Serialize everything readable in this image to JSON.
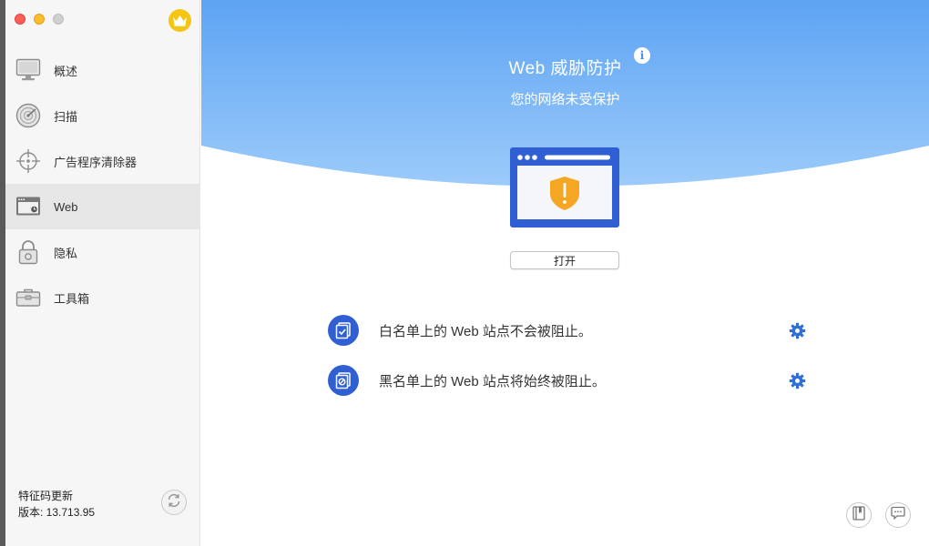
{
  "window": {
    "traffic_lights": [
      "close",
      "minimize",
      "maximize"
    ],
    "premium_icon": "crown-icon"
  },
  "sidebar": {
    "items": [
      {
        "label": "概述",
        "icon": "monitor-icon",
        "active": false
      },
      {
        "label": "扫描",
        "icon": "radar-icon",
        "active": false
      },
      {
        "label": "广告程序清除器",
        "icon": "crosshair-icon",
        "active": false
      },
      {
        "label": "Web",
        "icon": "browser-icon",
        "active": true
      },
      {
        "label": "隐私",
        "icon": "lock-icon",
        "active": false
      },
      {
        "label": "工具箱",
        "icon": "toolbox-icon",
        "active": false
      }
    ],
    "update": {
      "title": "特征码更新",
      "version": "版本: 13.713.95"
    }
  },
  "main": {
    "title": "Web 威胁防护",
    "subtitle": "您的网络未受保护",
    "open_button": "打开",
    "rows": [
      {
        "text": "白名单上的 Web 站点不会被阻止。",
        "icon": "whitelist-icon"
      },
      {
        "text": "黑名单上的 Web 站点将始终被阻止。",
        "icon": "blacklist-icon"
      }
    ]
  },
  "colors": {
    "hero_top": "#5da3f3",
    "hero_bottom": "#9ccbfa",
    "accent_blue": "#2f5fd3",
    "shield": "#f5a623",
    "gear": "#2f6fd6"
  }
}
